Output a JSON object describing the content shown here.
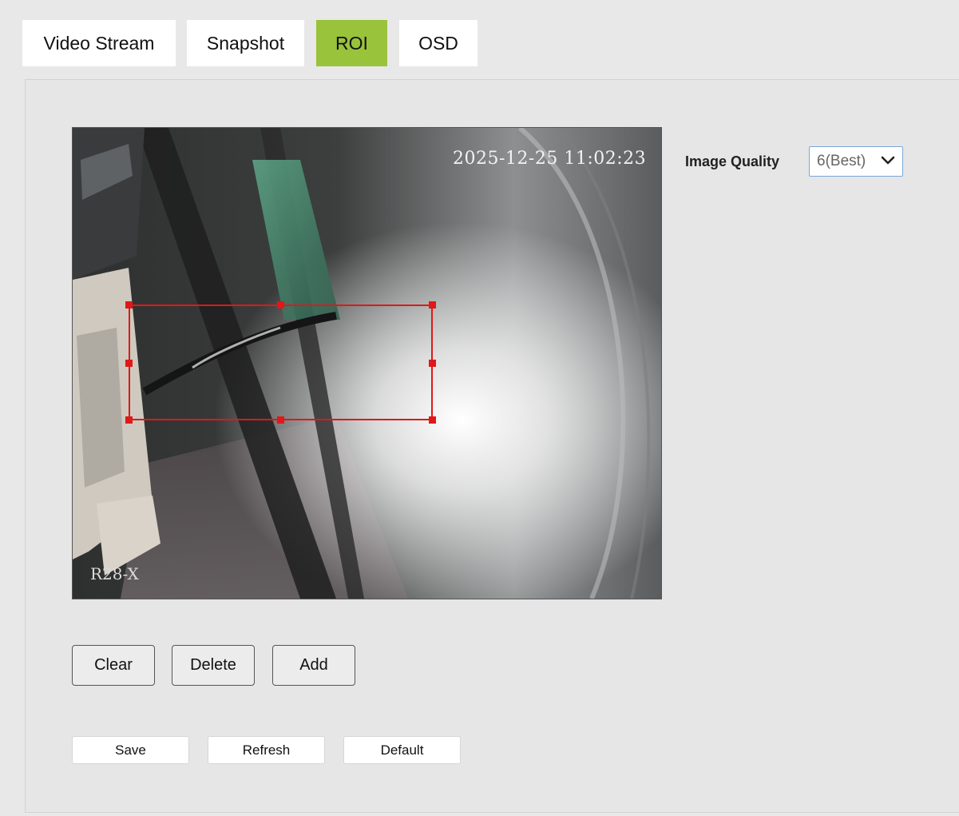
{
  "tabs": [
    {
      "label": "Video Stream",
      "active": false
    },
    {
      "label": "Snapshot",
      "active": false
    },
    {
      "label": "ROI",
      "active": true
    },
    {
      "label": "OSD",
      "active": false
    }
  ],
  "preview": {
    "osd_time": "2025-12-25 11:02:23",
    "osd_name": "R28-X"
  },
  "roi_actions": {
    "clear_label": "Clear",
    "delete_label": "Delete",
    "add_label": "Add"
  },
  "form_actions": {
    "save_label": "Save",
    "refresh_label": "Refresh",
    "default_label": "Default"
  },
  "image_quality": {
    "label": "Image Quality",
    "selected": "6(Best)",
    "chevron_icon": "chevron-down-icon"
  },
  "colors": {
    "active_tab": "#99c33b",
    "roi_box": "#e01818",
    "select_border": "#7aa7d8"
  }
}
